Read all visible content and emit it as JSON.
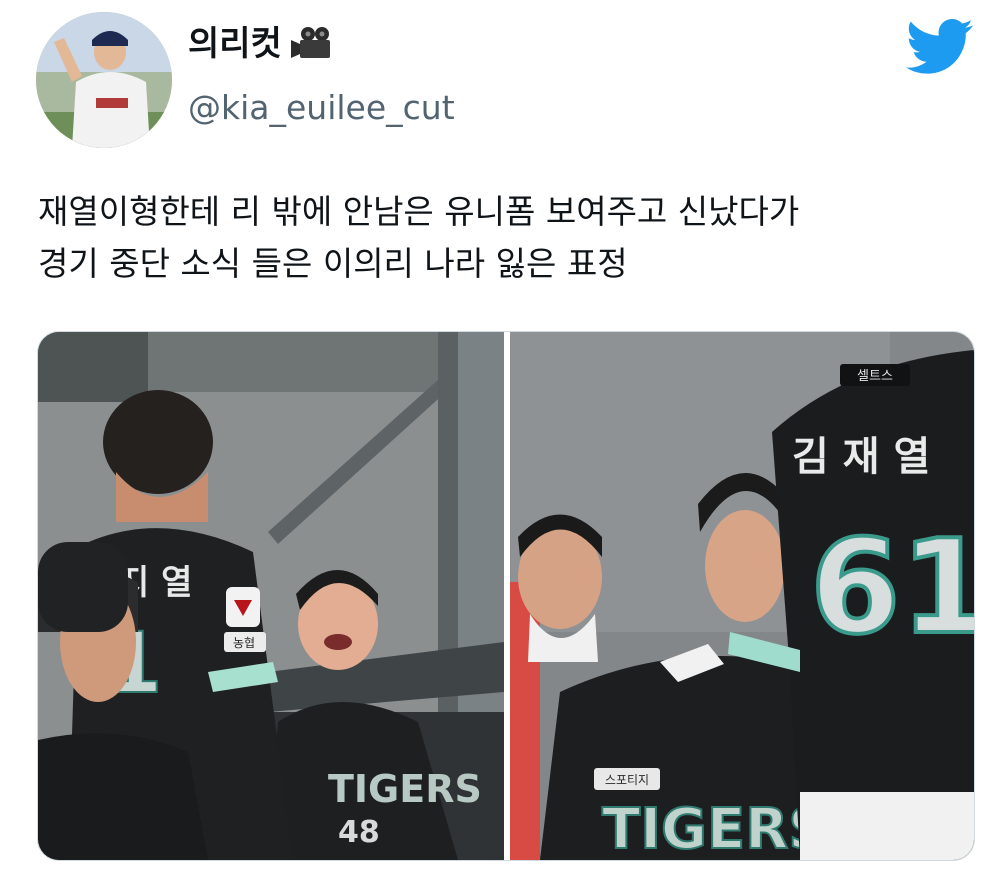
{
  "tweet": {
    "display_name": "의리컷",
    "name_emoji_icon": "movie-camera-icon",
    "handle": "@kia_euilee_cut",
    "text_lines": [
      "재열이형한테 리 밖에 안남은 유니폼 보여주고 신났다가",
      "경기 중단 소식 들은 이의리 나라 잃은 표정"
    ]
  },
  "brand_icon": "twitter-bird-icon",
  "brand_color": "#1d9bf0",
  "media": {
    "photo_count": 2,
    "left_photo": {
      "jersey_text_fragment": "지 열",
      "jersey_number_fragment": "1",
      "player_number": "48",
      "team_text": "TIGERS",
      "sleeve_patch": "농협"
    },
    "right_photo": {
      "jersey_name": "김 재 열",
      "jersey_number": "61",
      "collar_tag": "셀트스",
      "chest_patch": "스포티지",
      "team_text": "TIGERS"
    }
  }
}
